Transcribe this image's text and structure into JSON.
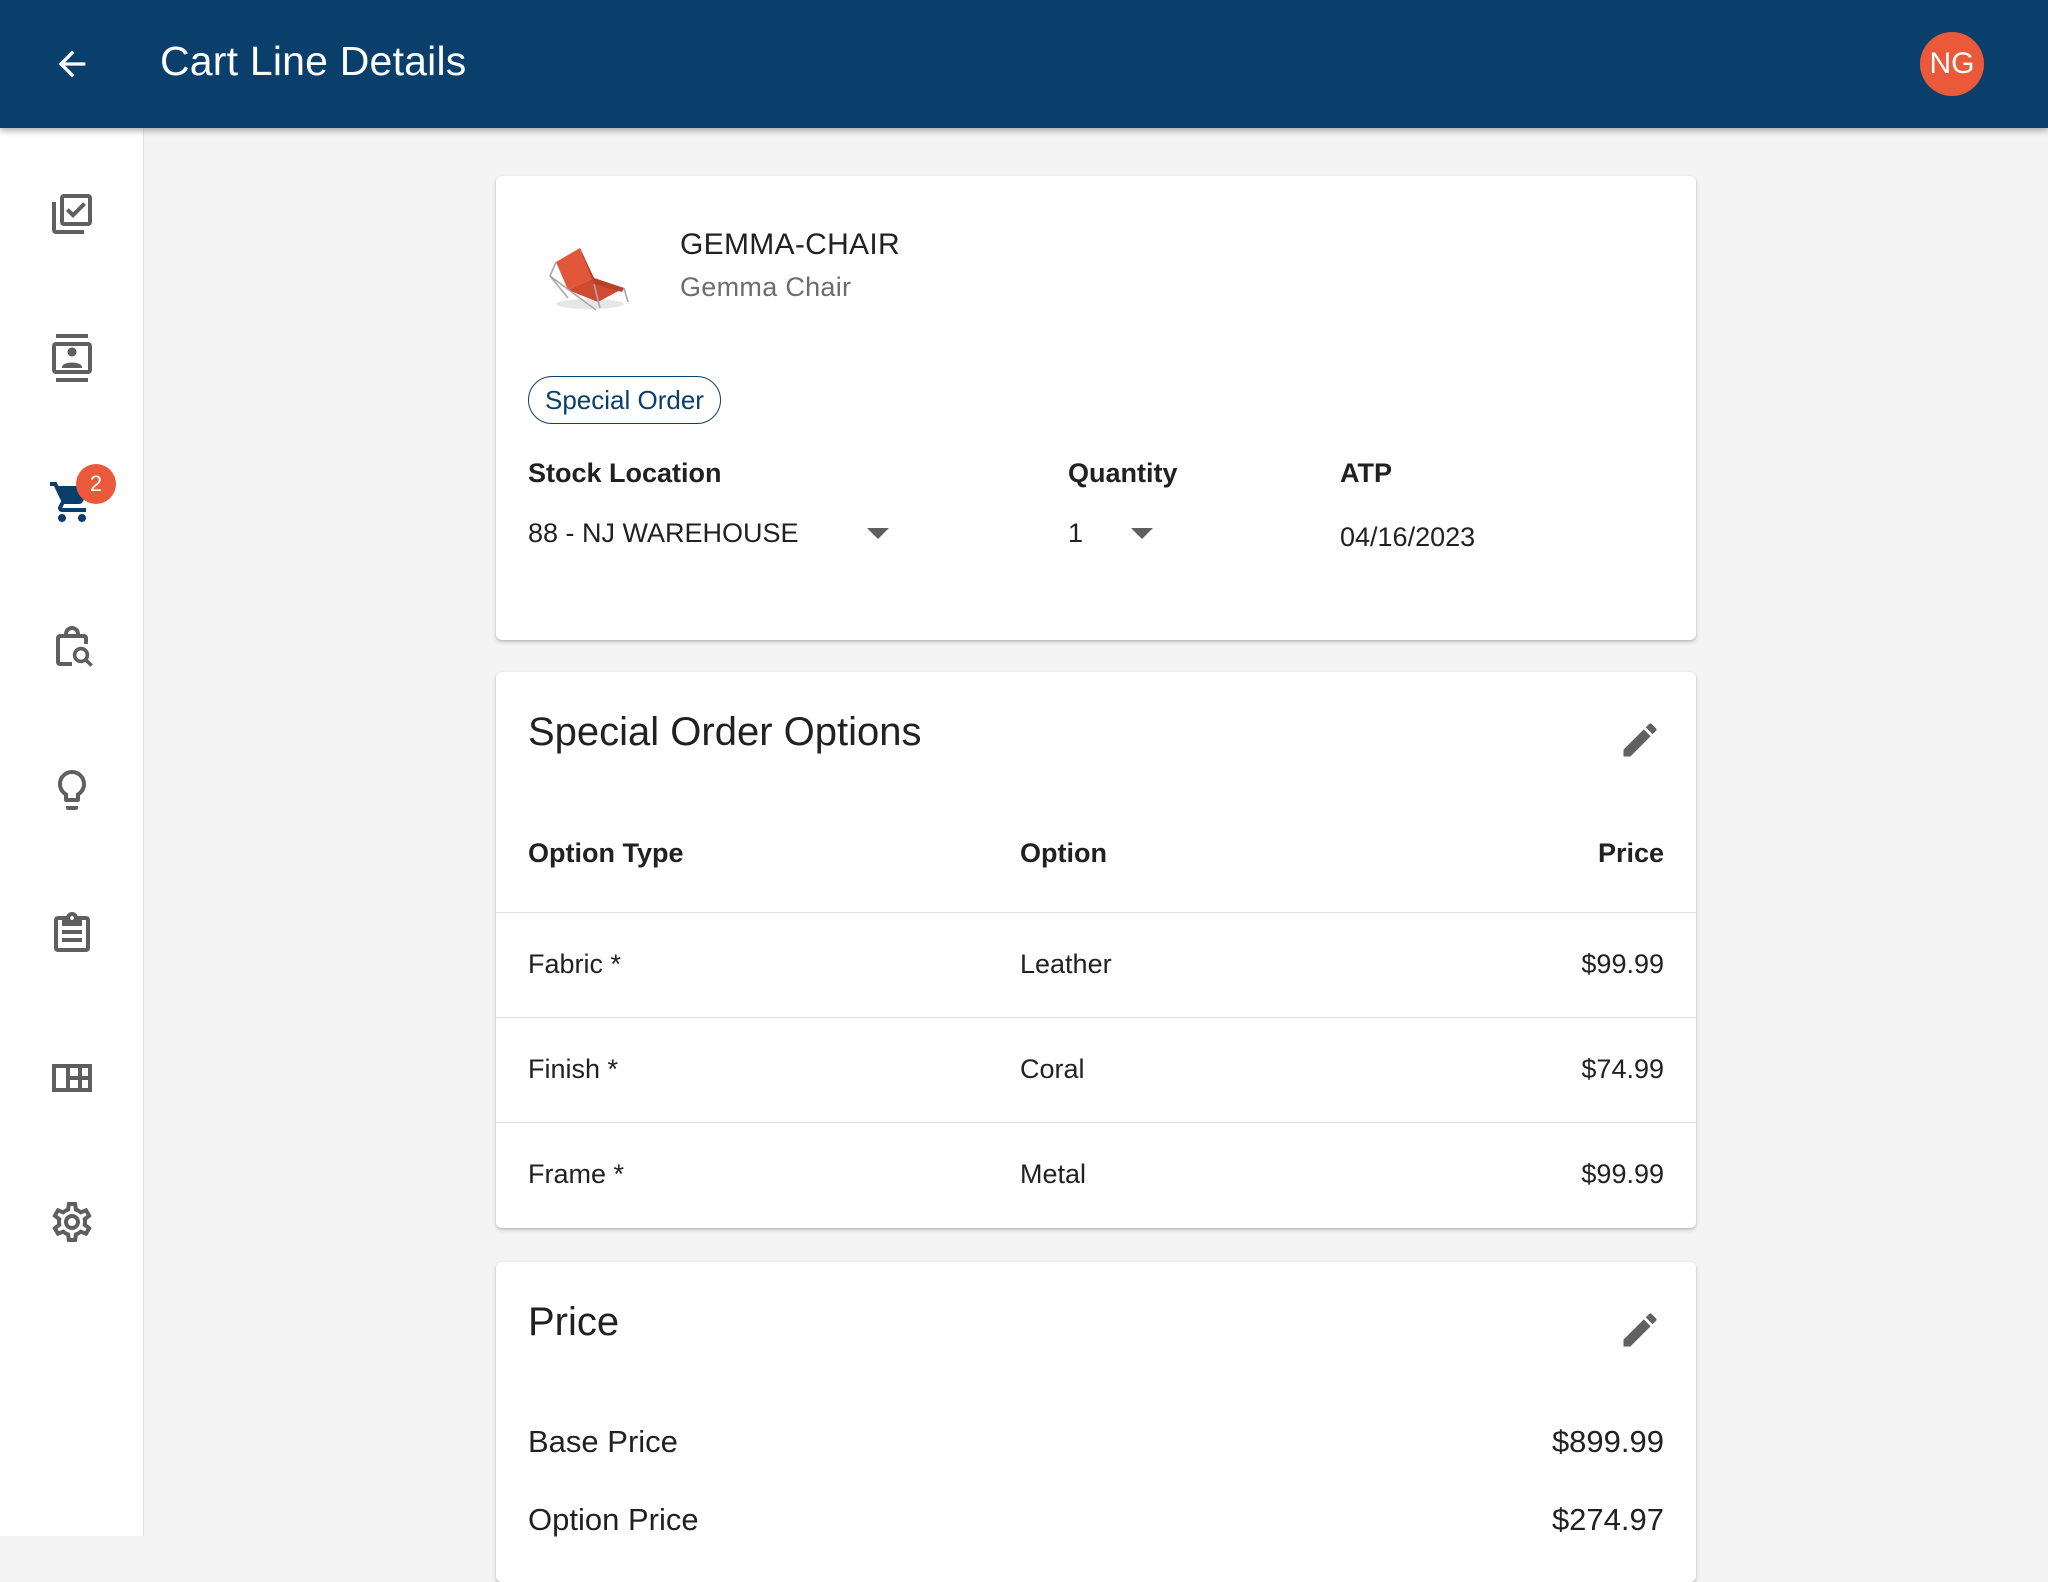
{
  "appbar": {
    "title": "Cart Line Details",
    "avatar_initials": "NG",
    "color": "#0b3f6b",
    "avatar_color": "#ea5a3a"
  },
  "sidebar": {
    "items": [
      {
        "icon": "checklist-icon"
      },
      {
        "icon": "contact-card-icon"
      },
      {
        "icon": "cart-icon",
        "badge": "2",
        "active": true
      },
      {
        "icon": "bag-search-icon"
      },
      {
        "icon": "lightbulb-icon"
      },
      {
        "icon": "clipboard-icon"
      },
      {
        "icon": "grid-icon"
      },
      {
        "icon": "gear-icon"
      }
    ]
  },
  "product": {
    "sku": "GEMMA-CHAIR",
    "name": "Gemma Chair",
    "tag": "Special Order",
    "stock_location_label": "Stock Location",
    "stock_location_value": "88 - NJ WAREHOUSE",
    "quantity_label": "Quantity",
    "quantity_value": "1",
    "atp_label": "ATP",
    "atp_value": "04/16/2023"
  },
  "options": {
    "title": "Special Order Options",
    "columns": [
      "Option Type",
      "Option",
      "Price"
    ],
    "rows": [
      {
        "type": "Fabric *",
        "option": "Leather",
        "price": "$99.99"
      },
      {
        "type": "Finish *",
        "option": "Coral",
        "price": "$74.99"
      },
      {
        "type": "Frame *",
        "option": "Metal",
        "price": "$99.99"
      }
    ]
  },
  "price": {
    "title": "Price",
    "base_label": "Base Price",
    "base_value": "$899.99",
    "option_label": "Option Price",
    "option_value": "$274.97"
  }
}
